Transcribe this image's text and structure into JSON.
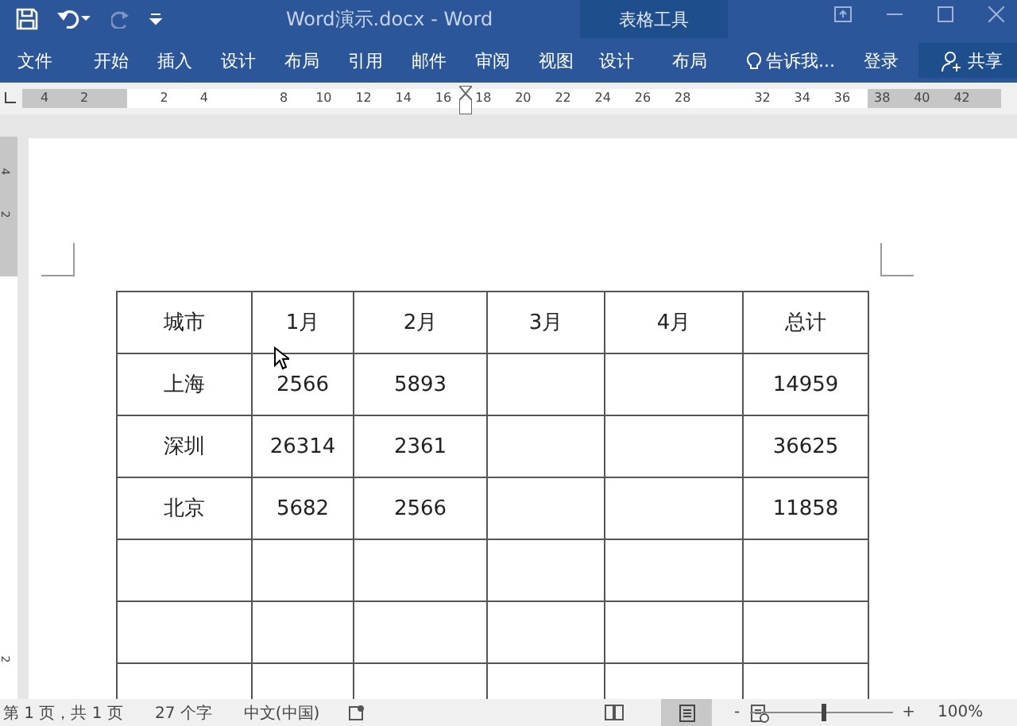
{
  "window": {
    "title": "Word演示.docx - Word",
    "context_group": "表格工具"
  },
  "tabs": [
    {
      "label": "文件",
      "selected": false
    },
    {
      "label": "开始",
      "selected": false
    },
    {
      "label": "插入",
      "selected": false
    },
    {
      "label": "设计",
      "selected": false
    },
    {
      "label": "布局",
      "selected": false
    },
    {
      "label": "引用",
      "selected": false
    },
    {
      "label": "邮件",
      "selected": false
    },
    {
      "label": "审阅",
      "selected": false
    },
    {
      "label": "视图",
      "selected": false
    }
  ],
  "context_tabs": [
    {
      "label": "设计",
      "selected": false
    },
    {
      "label": "布局",
      "selected": false
    }
  ],
  "tell_me": "告诉我...",
  "sign_in": "登录",
  "share": "共享",
  "ruler": {
    "ticks": [
      "4",
      "2",
      "2",
      "4",
      "8",
      "10",
      "12",
      "14",
      "16",
      "18",
      "20",
      "22",
      "24",
      "26",
      "28",
      "32",
      "34",
      "36",
      "38",
      "40",
      "42"
    ],
    "vertical_ticks": [
      "4",
      "2",
      "2"
    ]
  },
  "table": {
    "rows": [
      [
        "城市",
        "1月",
        "2月",
        "3月",
        "4月",
        "总计"
      ],
      [
        "上海",
        "2566",
        "5893",
        "",
        "",
        "14959"
      ],
      [
        "深圳",
        "26314",
        "2361",
        "",
        "",
        "36625"
      ],
      [
        "北京",
        "5682",
        "2566",
        "",
        "",
        "11858"
      ],
      [
        "",
        "",
        "",
        "",
        "",
        ""
      ],
      [
        "",
        "",
        "",
        "",
        "",
        ""
      ],
      [
        "",
        "",
        "",
        "",
        "",
        ""
      ]
    ]
  },
  "status_bar": {
    "page": "第 1 页，共 1 页",
    "words": "27 个字",
    "language": "中文(中国)",
    "zoom": "100%",
    "zoom_out": "-",
    "zoom_in": "+",
    "zoom_slider": {
      "level": 0.5
    }
  }
}
